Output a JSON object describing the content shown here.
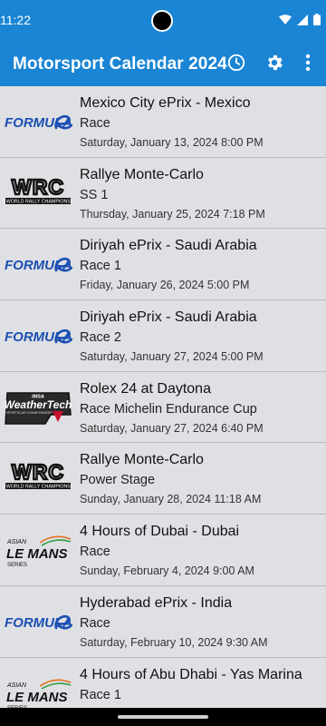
{
  "status_bar": {
    "time": "11:22"
  },
  "app_bar": {
    "title": "Motorsport Calendar 2024",
    "actions": [
      "history-icon",
      "settings-icon",
      "more-vert-icon"
    ]
  },
  "colors": {
    "primary": "#1a85d4",
    "list_bg": "#dfe0e4"
  },
  "logos": {
    "formula_e": {
      "text": "FORMULA",
      "color": "#1b4fb3"
    },
    "wrc": {
      "text": "WRC",
      "sub": "FIA WORLD RALLY CHAMPIONSHIP"
    },
    "imsa": {
      "top": "IMSA",
      "main": "WeatherTech",
      "sub": "SPORTSCAR CHAMPIONSHIP"
    },
    "alms": {
      "top": "ASIAN",
      "main": "LE MANS",
      "sub": "SERIES"
    }
  },
  "events": [
    {
      "series": "formula_e",
      "title": "Mexico City ePrix - Mexico",
      "session": "Race",
      "date": "Saturday, January 13, 2024 8:00 PM"
    },
    {
      "series": "wrc",
      "title": "Rallye Monte-Carlo",
      "session": "SS 1",
      "date": "Thursday, January 25, 2024 7:18 PM"
    },
    {
      "series": "formula_e",
      "title": "Diriyah ePrix - Saudi Arabia",
      "session": "Race 1",
      "date": "Friday, January 26, 2024 5:00 PM"
    },
    {
      "series": "formula_e",
      "title": "Diriyah ePrix - Saudi Arabia",
      "session": "Race 2",
      "date": "Saturday, January 27, 2024 5:00 PM"
    },
    {
      "series": "imsa",
      "title": "Rolex 24 at Daytona",
      "session": "Race Michelin Endurance Cup",
      "date": "Saturday, January 27, 2024 6:40 PM"
    },
    {
      "series": "wrc",
      "title": "Rallye Monte-Carlo",
      "session": "Power Stage",
      "date": "Sunday, January 28, 2024 11:18 AM"
    },
    {
      "series": "alms",
      "title": "4 Hours of Dubai - Dubai",
      "session": "Race",
      "date": "Sunday, February 4, 2024 9:00 AM"
    },
    {
      "series": "formula_e",
      "title": "Hyderabad ePrix - India",
      "session": "Race",
      "date": "Saturday, February 10, 2024 9:30 AM"
    },
    {
      "series": "alms",
      "title": "4 Hours of Abu Dhabi - Yas Marina",
      "session": "Race 1",
      "date": ""
    }
  ]
}
